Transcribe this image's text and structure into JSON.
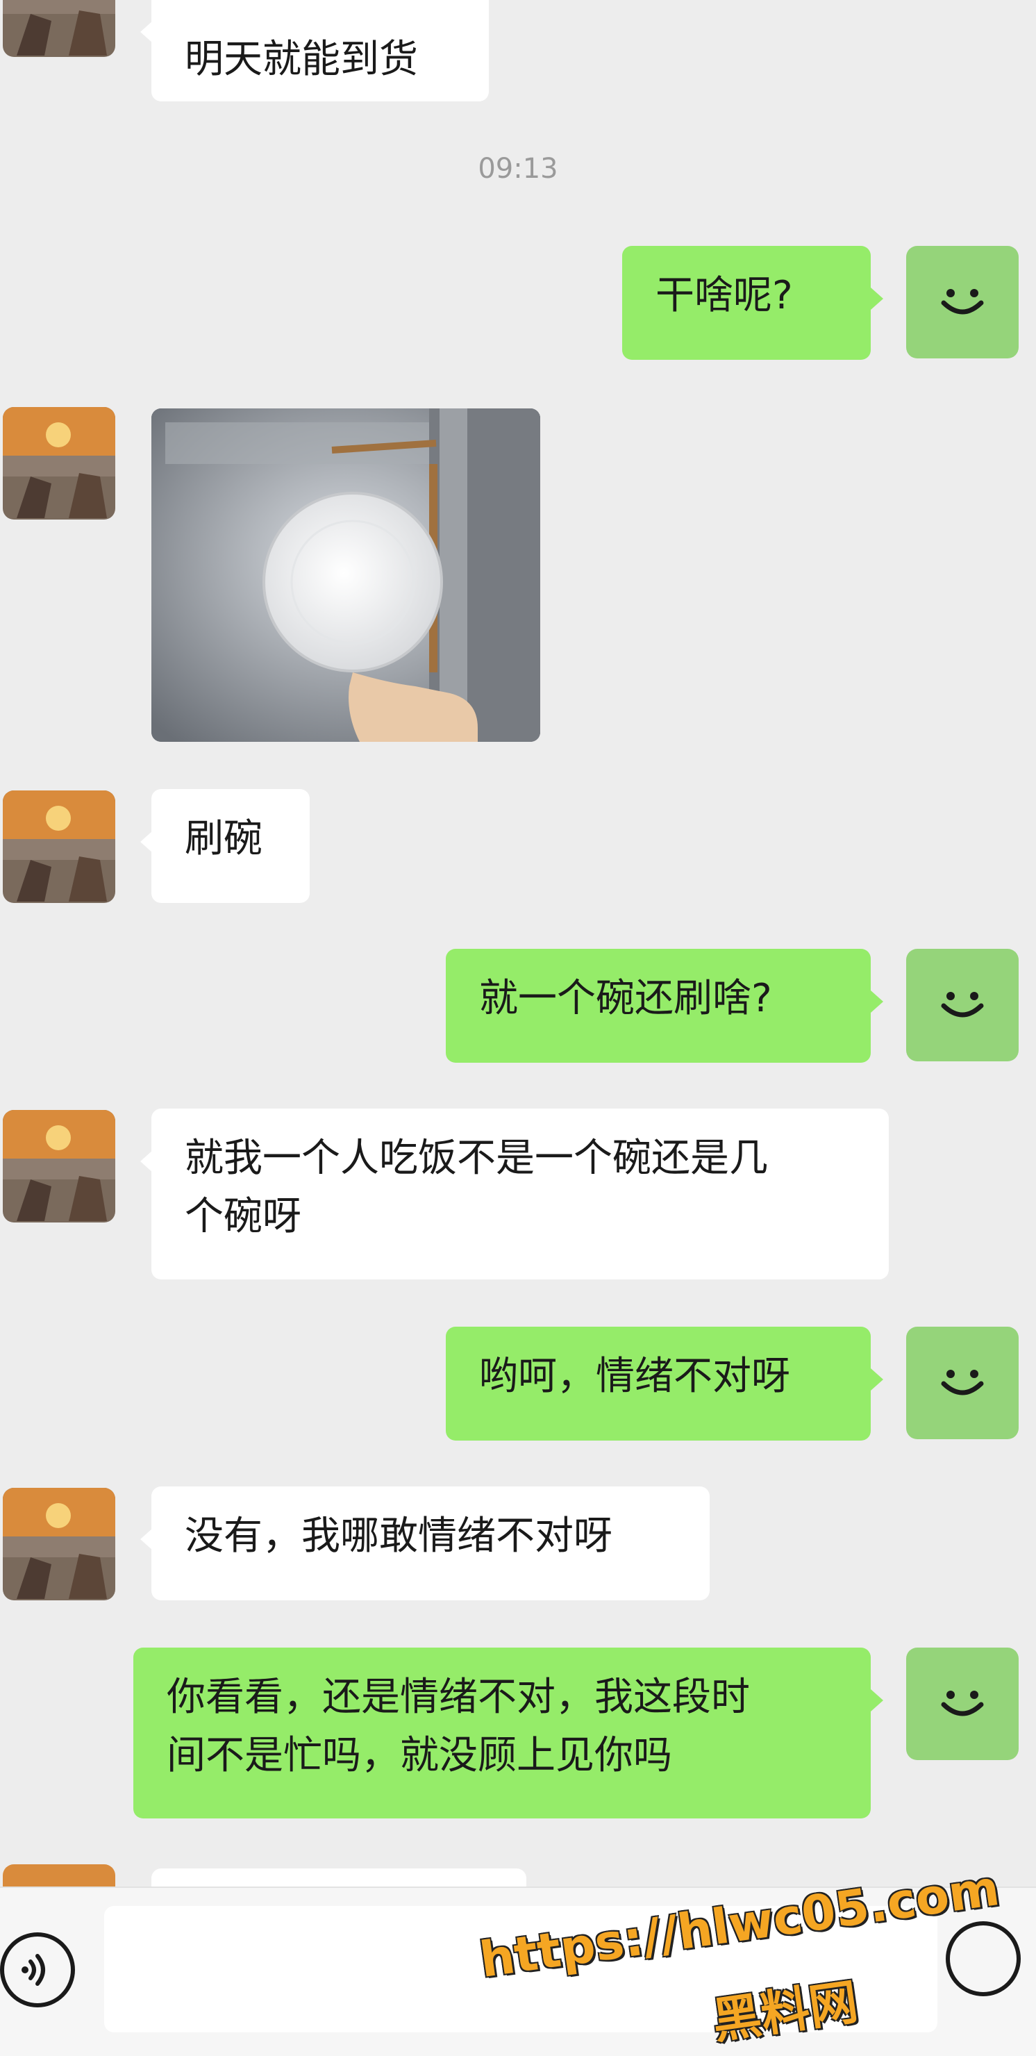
{
  "messages": {
    "m0_text": "明天就能到货",
    "time": "09:13",
    "m1_text": "干啥呢?",
    "m3_text": "刷碗",
    "m4_text": "就一个碗还刷啥?",
    "m5_line1": "就我一个人吃饭不是一个碗还是几",
    "m5_line2": "个碗呀",
    "m6_text": "哟呵，情绪不对呀",
    "m7_text": "没有，我哪敢情绪不对呀",
    "m8_line1": "你看看，还是情绪不对，我这段时",
    "m8_line2": "间不是忙吗，就没顾上见你吗"
  },
  "watermark": {
    "url": "https://hlwc05.com",
    "name": "黑料网"
  },
  "icons": {
    "voice": "voice-icon",
    "emoji": "emoji-icon",
    "self_avatar": "smiley-avatar-icon"
  },
  "colors": {
    "background": "#ededed",
    "outgoing_bubble": "#95ec69",
    "incoming_bubble": "#ffffff",
    "self_avatar": "#95d47a",
    "watermark": "#f5a623"
  }
}
